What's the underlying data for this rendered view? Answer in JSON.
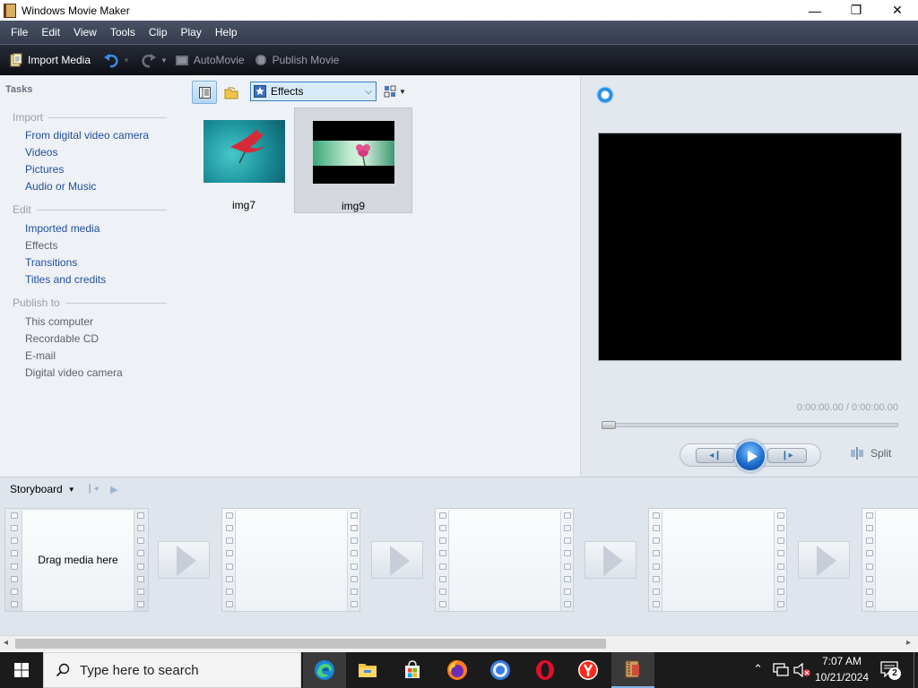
{
  "window": {
    "title": "Windows Movie Maker",
    "minimize": "—",
    "maximize": "❐",
    "close": "✕"
  },
  "menu": [
    "File",
    "Edit",
    "View",
    "Tools",
    "Clip",
    "Play",
    "Help"
  ],
  "toolbar": {
    "import_media": "Import Media",
    "automovie": "AutoMovie",
    "publish_movie": "Publish Movie"
  },
  "tasks": {
    "header": "Tasks",
    "import": {
      "label": "Import",
      "items": [
        "From digital video camera",
        "Videos",
        "Pictures",
        "Audio or Music"
      ]
    },
    "edit": {
      "label": "Edit",
      "items": [
        "Imported media",
        "Effects",
        "Transitions",
        "Titles and credits"
      ]
    },
    "publish": {
      "label": "Publish to",
      "items": [
        "This computer",
        "Recordable CD",
        "E-mail",
        "Digital video camera"
      ]
    }
  },
  "collection": {
    "dropdown_value": "Effects",
    "items": [
      {
        "name": "img7",
        "selected": false
      },
      {
        "name": "img9",
        "selected": true
      }
    ]
  },
  "preview": {
    "time": "0:00:00.00 / 0:00:00.00",
    "split": "Split"
  },
  "storyboard": {
    "label": "Storyboard",
    "drop_hint": "Drag media here"
  },
  "taskbar": {
    "search_placeholder": "Type here to search",
    "time": "7:07 AM",
    "date": "10/21/2024",
    "notification_count": "2"
  },
  "colors": {
    "link": "#1f4f9f",
    "accent_blue": "#1e6fd0",
    "taskbar": "#1b1b1b"
  }
}
